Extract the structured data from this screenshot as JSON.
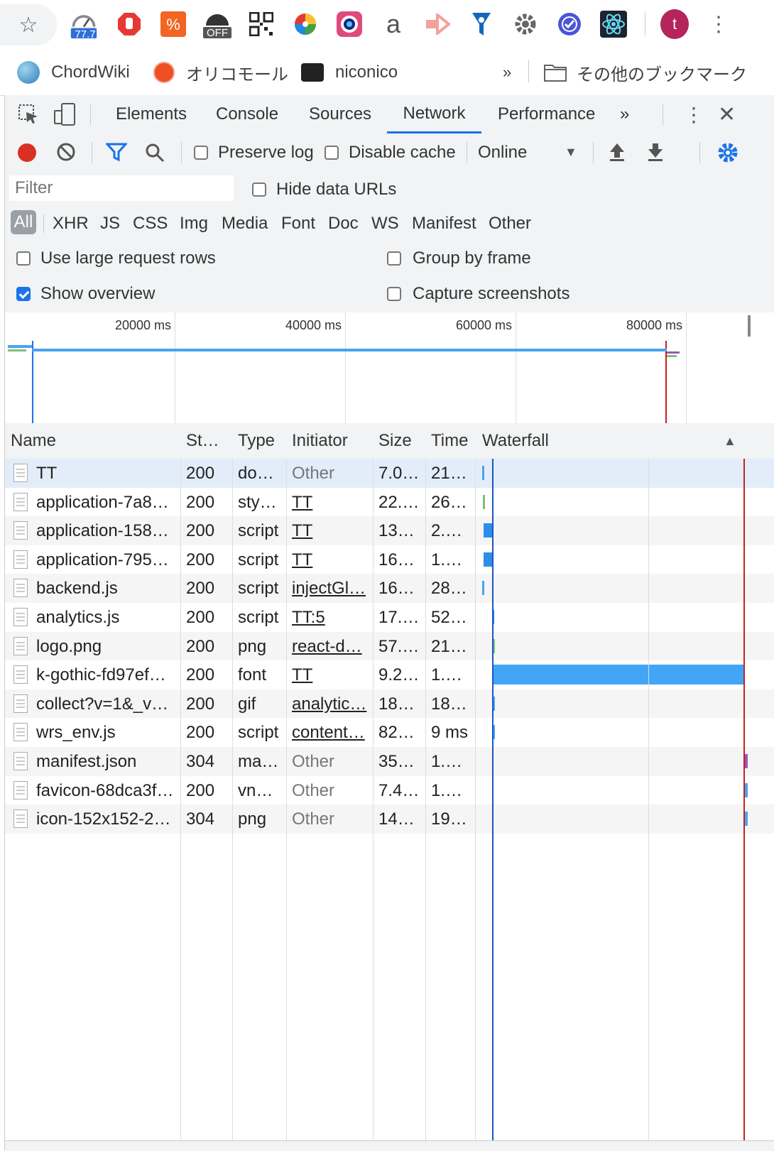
{
  "extensions": {
    "speed_badge": "77.7",
    "off_badge": "OFF",
    "profile_initial": "t",
    "icons": [
      "star-icon",
      "speedometer-extension-icon",
      "adblock-hand-icon",
      "percent-extension-icon",
      "off-extension-icon",
      "qr-code-icon",
      "color-wheel-icon",
      "camera-lens-icon",
      "amazon-a-icon",
      "arrow-extension-icon",
      "filter-funnel-icon",
      "gear-extension-icon",
      "check-circle-icon",
      "react-atom-icon",
      "profile-avatar",
      "more-vert-icon"
    ]
  },
  "bookmarks": {
    "items": [
      {
        "label": "ChordWiki"
      },
      {
        "label": "オリコモール"
      },
      {
        "label": "niconico"
      }
    ],
    "overflow": "»",
    "other": "その他のブックマーク"
  },
  "devtools": {
    "tabs": [
      "Elements",
      "Console",
      "Sources",
      "Network",
      "Performance"
    ],
    "active_tab": "Network",
    "more_tabs": "»",
    "toolbar": {
      "preserve_log": "Preserve log",
      "disable_cache": "Disable cache",
      "throttling": "Online"
    },
    "filter": {
      "placeholder": "Filter",
      "hide_data_urls": "Hide data URLs"
    },
    "types": [
      "All",
      "XHR",
      "JS",
      "CSS",
      "Img",
      "Media",
      "Font",
      "Doc",
      "WS",
      "Manifest",
      "Other"
    ],
    "settings": {
      "large_rows": "Use large request rows",
      "group_by_frame": "Group by frame",
      "show_overview": "Show overview",
      "capture_screenshots": "Capture screenshots"
    },
    "overview_ticks": [
      "20000 ms",
      "40000 ms",
      "60000 ms",
      "80000 ms"
    ],
    "columns": {
      "name": "Name",
      "status": "St…",
      "type": "Type",
      "initiator": "Initiator",
      "size": "Size",
      "time": "Time",
      "waterfall": "Waterfall",
      "sort_indicator": "▲"
    },
    "rows": [
      {
        "name": "TT",
        "status": "200",
        "type": "do…",
        "initiator": "Other",
        "size": "7.0…",
        "time": "21…",
        "init_link": false,
        "icon": "doc"
      },
      {
        "name": "application-7a8…",
        "status": "200",
        "type": "sty…",
        "initiator": "TT",
        "size": "22.…",
        "time": "26…",
        "init_link": true,
        "icon": "doc"
      },
      {
        "name": "application-158…",
        "status": "200",
        "type": "script",
        "initiator": "TT",
        "size": "13…",
        "time": "2.…",
        "init_link": true,
        "icon": "doc"
      },
      {
        "name": "application-795…",
        "status": "200",
        "type": "script",
        "initiator": "TT",
        "size": "16…",
        "time": "1.…",
        "init_link": true,
        "icon": "doc"
      },
      {
        "name": "backend.js",
        "status": "200",
        "type": "script",
        "initiator": "injectGl…",
        "size": "16…",
        "time": "28…",
        "init_link": true,
        "icon": "doc"
      },
      {
        "name": "analytics.js",
        "status": "200",
        "type": "script",
        "initiator": "TT:5",
        "size": "17.…",
        "time": "52…",
        "init_link": true,
        "icon": "doc"
      },
      {
        "name": "logo.png",
        "status": "200",
        "type": "png",
        "initiator": "react-d…",
        "size": "57.…",
        "time": "21…",
        "init_link": true,
        "icon": "img"
      },
      {
        "name": "k-gothic-fd97ef…",
        "status": "200",
        "type": "font",
        "initiator": "TT",
        "size": "9.2…",
        "time": "1.…",
        "init_link": true,
        "icon": "blank"
      },
      {
        "name": "collect?v=1&_v…",
        "status": "200",
        "type": "gif",
        "initiator": "analytic…",
        "size": "18…",
        "time": "18…",
        "init_link": true,
        "icon": "blank"
      },
      {
        "name": "wrs_env.js",
        "status": "200",
        "type": "script",
        "initiator": "content…",
        "size": "82…",
        "time": "9 ms",
        "init_link": true,
        "icon": "doc"
      },
      {
        "name": "manifest.json",
        "status": "304",
        "type": "ma…",
        "initiator": "Other",
        "size": "35…",
        "time": "1.…",
        "init_link": false,
        "icon": "blank"
      },
      {
        "name": "favicon-68dca3f…",
        "status": "200",
        "type": "vn…",
        "initiator": "Other",
        "size": "7.4…",
        "time": "1.…",
        "init_link": false,
        "icon": "blank"
      },
      {
        "name": "icon-152x152-2…",
        "status": "304",
        "type": "png",
        "initiator": "Other",
        "size": "14…",
        "time": "19…",
        "init_link": false,
        "icon": "blank"
      }
    ],
    "accent_color": "#1a73e8",
    "record_color": "#d93025"
  }
}
